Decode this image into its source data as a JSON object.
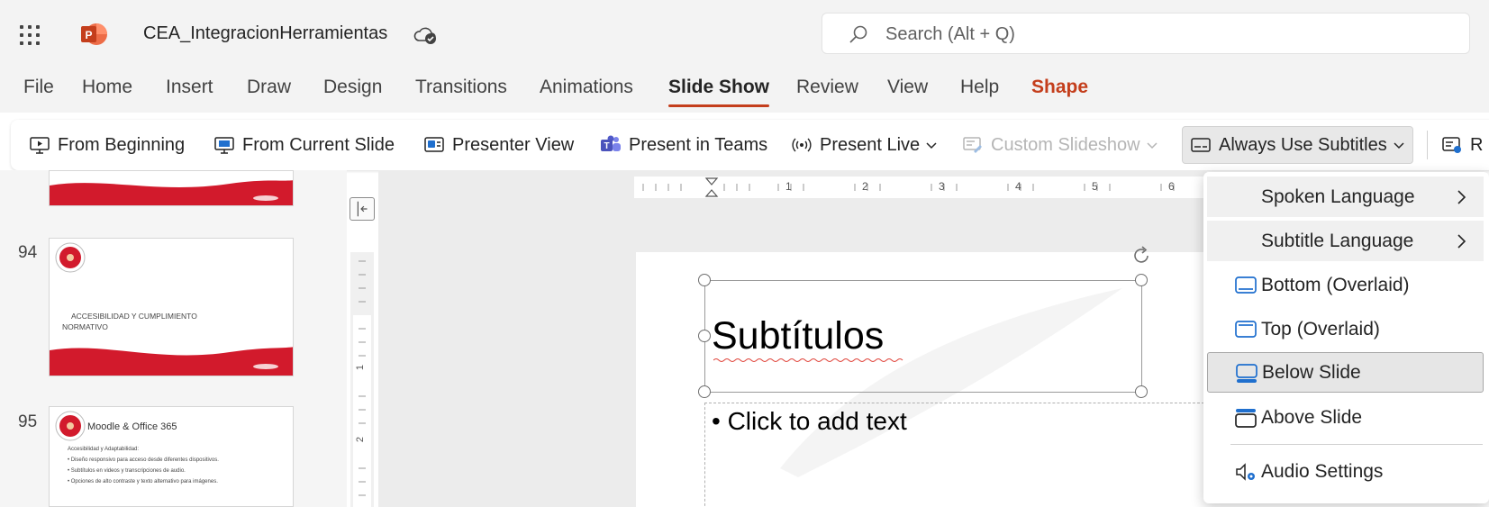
{
  "app": {
    "document_title": "CEA_IntegracionHerramientas",
    "search_placeholder": "Search (Alt + Q)"
  },
  "menu_tabs": [
    {
      "label": "File"
    },
    {
      "label": "Home"
    },
    {
      "label": "Insert"
    },
    {
      "label": "Draw"
    },
    {
      "label": "Design"
    },
    {
      "label": "Transitions"
    },
    {
      "label": "Animations"
    },
    {
      "label": "Slide Show",
      "active": true
    },
    {
      "label": "Review"
    },
    {
      "label": "View"
    },
    {
      "label": "Help"
    },
    {
      "label": "Shape",
      "contextual": true
    }
  ],
  "ribbon": {
    "buttons": [
      {
        "label": "From Beginning",
        "icon": "play-screen-icon"
      },
      {
        "label": "From Current Slide",
        "icon": "play-screen-icon"
      },
      {
        "label": "Presenter View",
        "icon": "presenter-view-icon"
      },
      {
        "label": "Present in Teams",
        "icon": "teams-icon"
      },
      {
        "label": "Present Live",
        "icon": "broadcast-icon"
      },
      {
        "label": "Custom Slideshow",
        "icon": "custom-slideshow-icon",
        "disabled": true
      },
      {
        "label": "Always Use Subtitles",
        "icon": "subtitles-icon",
        "pressed": true
      },
      {
        "label": "R",
        "icon": "rehearse-icon"
      }
    ]
  },
  "slides_panel": {
    "thumbnails": [
      {
        "number": "",
        "text": ""
      },
      {
        "number": "94",
        "text": "ACCESIBILIDAD Y CUMPLIMIENTO NORMATIVO"
      },
      {
        "number": "95",
        "title": "Moodle & Office 365",
        "lines": [
          "Accesibilidad y Adaptabilidad:",
          "• Diseño responsivo para acceso desde diferentes dispositivos.",
          "• Subtítulos en videos y transcripciones de audio.",
          "• Opciones de alto contraste y texto alternativo para imágenes."
        ]
      }
    ]
  },
  "ruler": {
    "h_numbers": [
      "1",
      "2",
      "3",
      "4",
      "5",
      "6"
    ],
    "v_numbers": [
      "1",
      "2"
    ]
  },
  "slide": {
    "title": "Subtítulos",
    "body_placeholder": "• Click to add text"
  },
  "subtitles_menu": {
    "items": [
      {
        "label": "Spoken Language",
        "submenu": true
      },
      {
        "label": "Subtitle Language",
        "submenu": true
      },
      {
        "label": "Bottom (Overlaid)",
        "icon": "bottom-overlaid-icon"
      },
      {
        "label": "Top (Overlaid)",
        "icon": "top-overlaid-icon"
      },
      {
        "label": "Below Slide",
        "icon": "below-slide-icon",
        "selected": true
      },
      {
        "label": "Above Slide",
        "icon": "above-slide-icon"
      },
      {
        "label": "Audio Settings",
        "icon": "audio-settings-icon"
      }
    ]
  },
  "colors": {
    "accent": "#c43e1c",
    "titlebar_bg": "#f3f3f3",
    "brand_red": "#d21a2c",
    "icon_blue": "#1f6fce"
  }
}
